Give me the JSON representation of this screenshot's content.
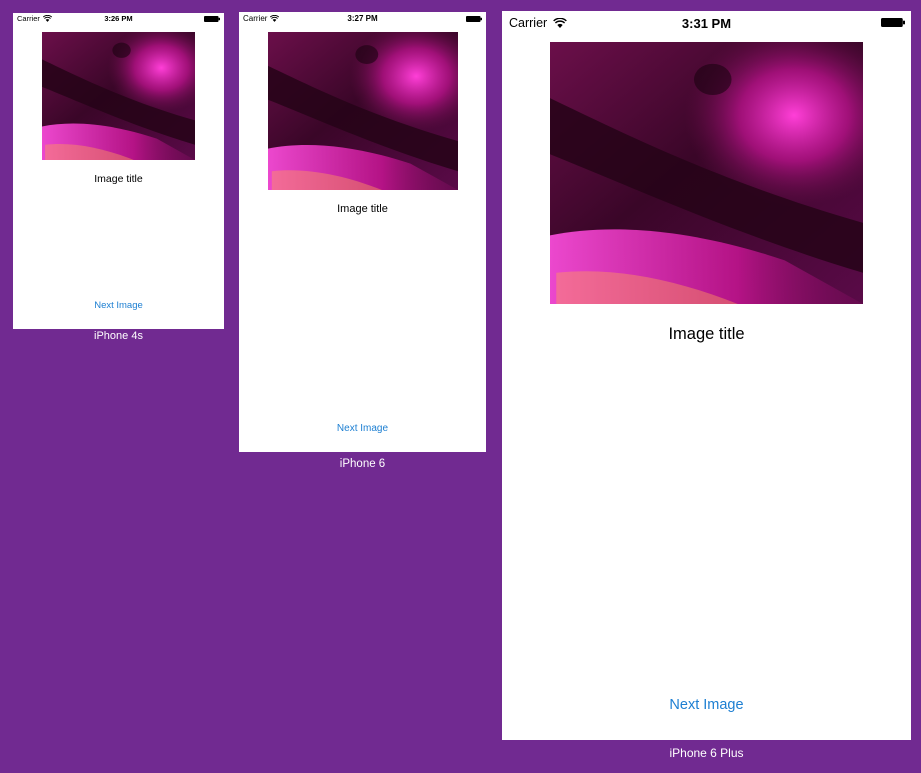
{
  "colors": {
    "background": "#712a91",
    "screen": "#ffffff",
    "link": "#1d7fd2",
    "caption": "#ffffff"
  },
  "devices": [
    {
      "caption": "iPhone 4s",
      "status_bar": {
        "carrier": "Carrier",
        "time": "3:26 PM",
        "wifi_icon": "wifi-icon",
        "battery_icon": "battery-icon"
      },
      "image": {
        "icon": "photo",
        "description_visible": false
      },
      "title": "Image title",
      "button_label": "Next Image"
    },
    {
      "caption": "iPhone 6",
      "status_bar": {
        "carrier": "Carrier",
        "time": "3:27 PM",
        "wifi_icon": "wifi-icon",
        "battery_icon": "battery-icon"
      },
      "image": {
        "icon": "photo",
        "description_visible": false
      },
      "title": "Image title",
      "button_label": "Next Image"
    },
    {
      "caption": "iPhone 6 Plus",
      "status_bar": {
        "carrier": "Carrier",
        "time": "3:31 PM",
        "wifi_icon": "wifi-icon",
        "battery_icon": "battery-icon"
      },
      "image": {
        "icon": "photo",
        "description_visible": false
      },
      "title": "Image title",
      "button_label": "Next Image"
    }
  ]
}
